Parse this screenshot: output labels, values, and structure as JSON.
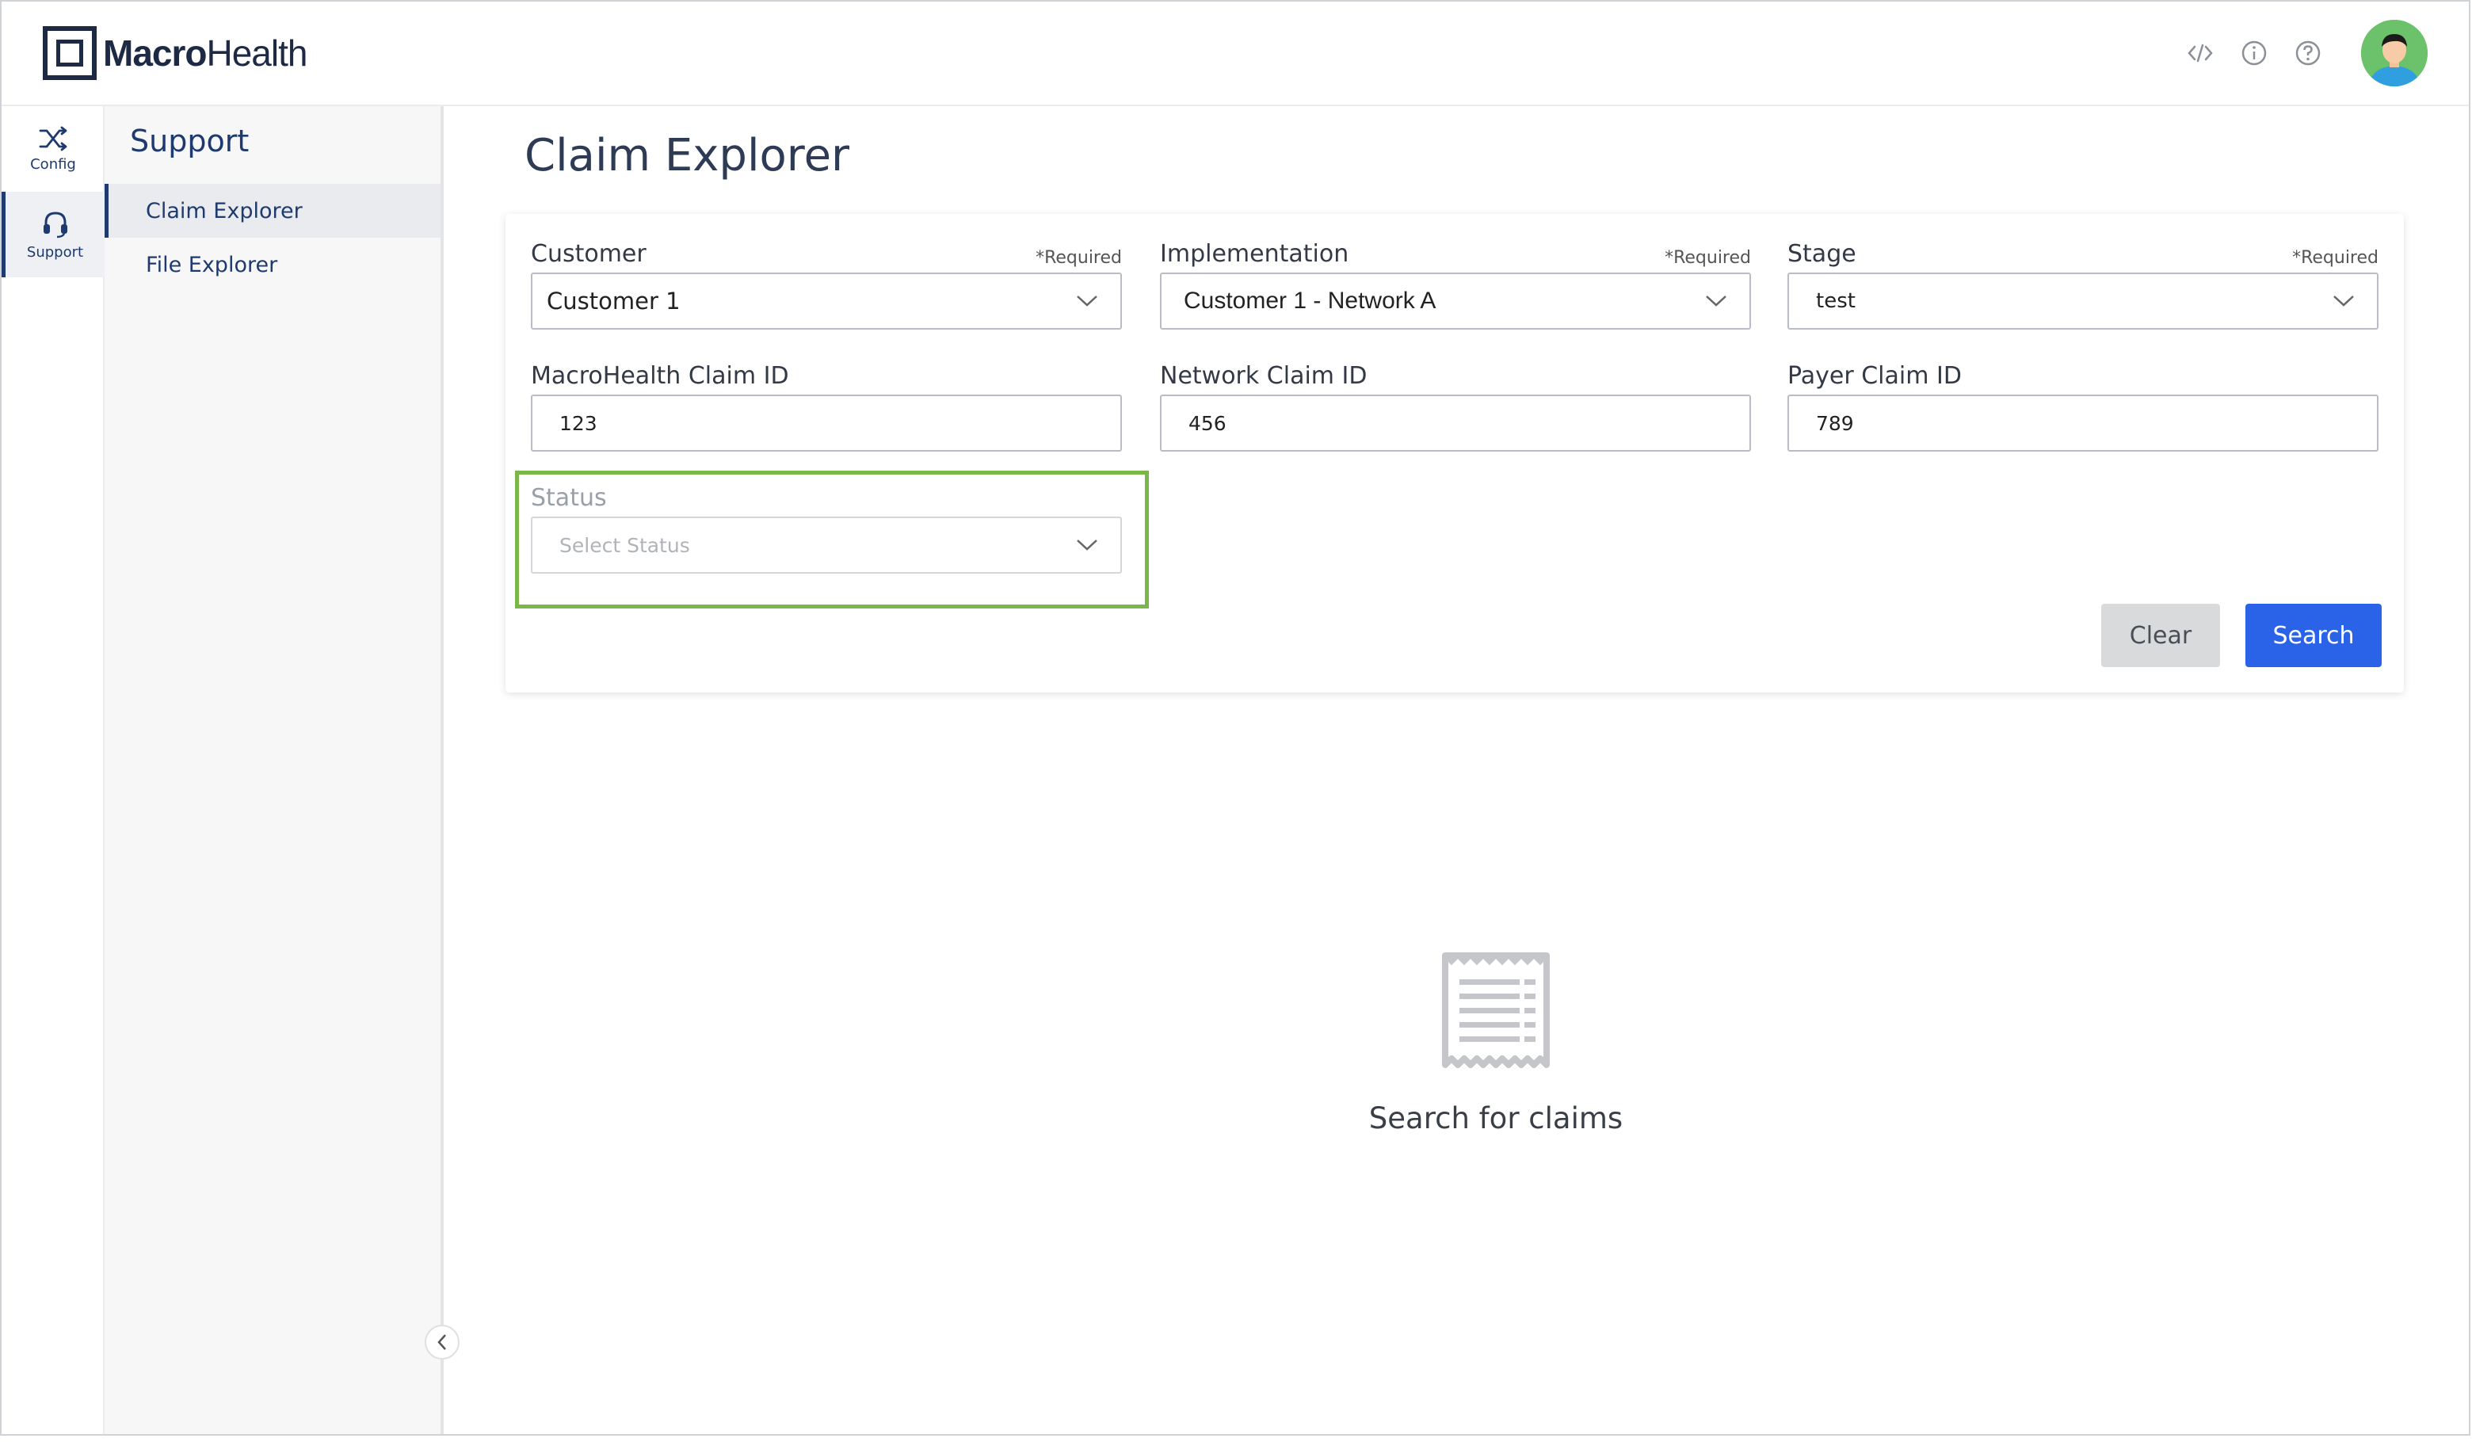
{
  "app": {
    "logo_bold": "Macro",
    "logo_light": "Health"
  },
  "header": {
    "icons": [
      "code-icon",
      "info-icon",
      "help-icon"
    ]
  },
  "rail": [
    {
      "label": "Config",
      "icon": "shuffle-icon",
      "active": false
    },
    {
      "label": "Support",
      "icon": "headset-icon",
      "active": true
    }
  ],
  "sidebar": {
    "title": "Support",
    "items": [
      {
        "label": "Claim Explorer",
        "active": true
      },
      {
        "label": "File Explorer",
        "active": false
      }
    ]
  },
  "main": {
    "title": "Claim Explorer",
    "form": {
      "customer": {
        "label": "Customer",
        "required": "*Required",
        "value": "Customer 1"
      },
      "implementation": {
        "label": "Implementation",
        "required": "*Required",
        "value": "Customer 1 - Network A"
      },
      "stage": {
        "label": "Stage",
        "required": "*Required",
        "value": "test"
      },
      "macrohealth_claim_id": {
        "label": "MacroHealth Claim ID",
        "value": "123"
      },
      "network_claim_id": {
        "label": "Network Claim ID",
        "value": "456"
      },
      "payer_claim_id": {
        "label": "Payer Claim ID",
        "value": "789"
      },
      "status": {
        "label": "Status",
        "placeholder": "Select Status"
      },
      "clear_label": "Clear",
      "search_label": "Search"
    },
    "empty_state": {
      "text": "Search for claims",
      "icon": "receipt-icon"
    }
  },
  "colors": {
    "primary": "#2b63e8",
    "navy": "#1e3a6e",
    "highlight": "#7ab648"
  }
}
